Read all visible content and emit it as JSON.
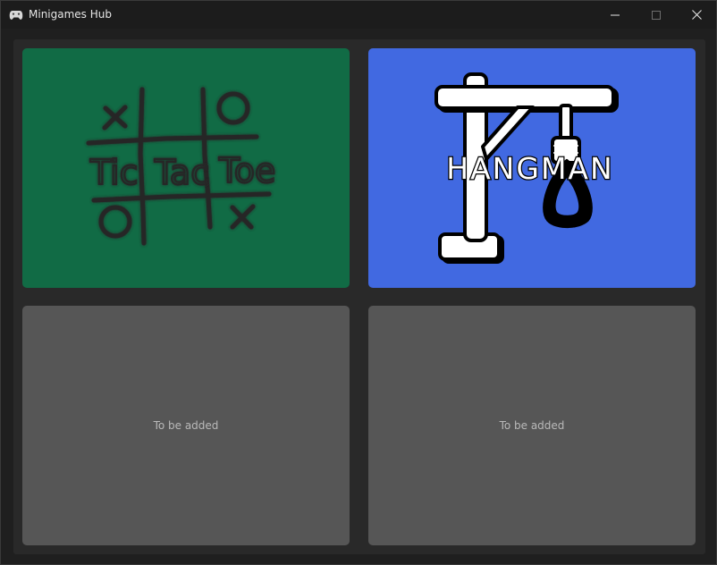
{
  "window": {
    "title": "Minigames Hub",
    "icon": "gamepad-icon"
  },
  "controls": {
    "minimize_icon": "minimize-icon",
    "maximize_icon": "maximize-icon",
    "close_icon": "close-icon"
  },
  "games": [
    {
      "name": "Tic Tac Toe",
      "logo_text": [
        "Tic",
        "Tac",
        "Toe"
      ],
      "background": "#116b45"
    },
    {
      "name": "Hangman",
      "logo_text": "HANGMAN",
      "background": "#4169e1"
    }
  ],
  "placeholders": [
    {
      "label": "To be added",
      "background": "#565656"
    },
    {
      "label": "To be added",
      "background": "#565656"
    }
  ]
}
